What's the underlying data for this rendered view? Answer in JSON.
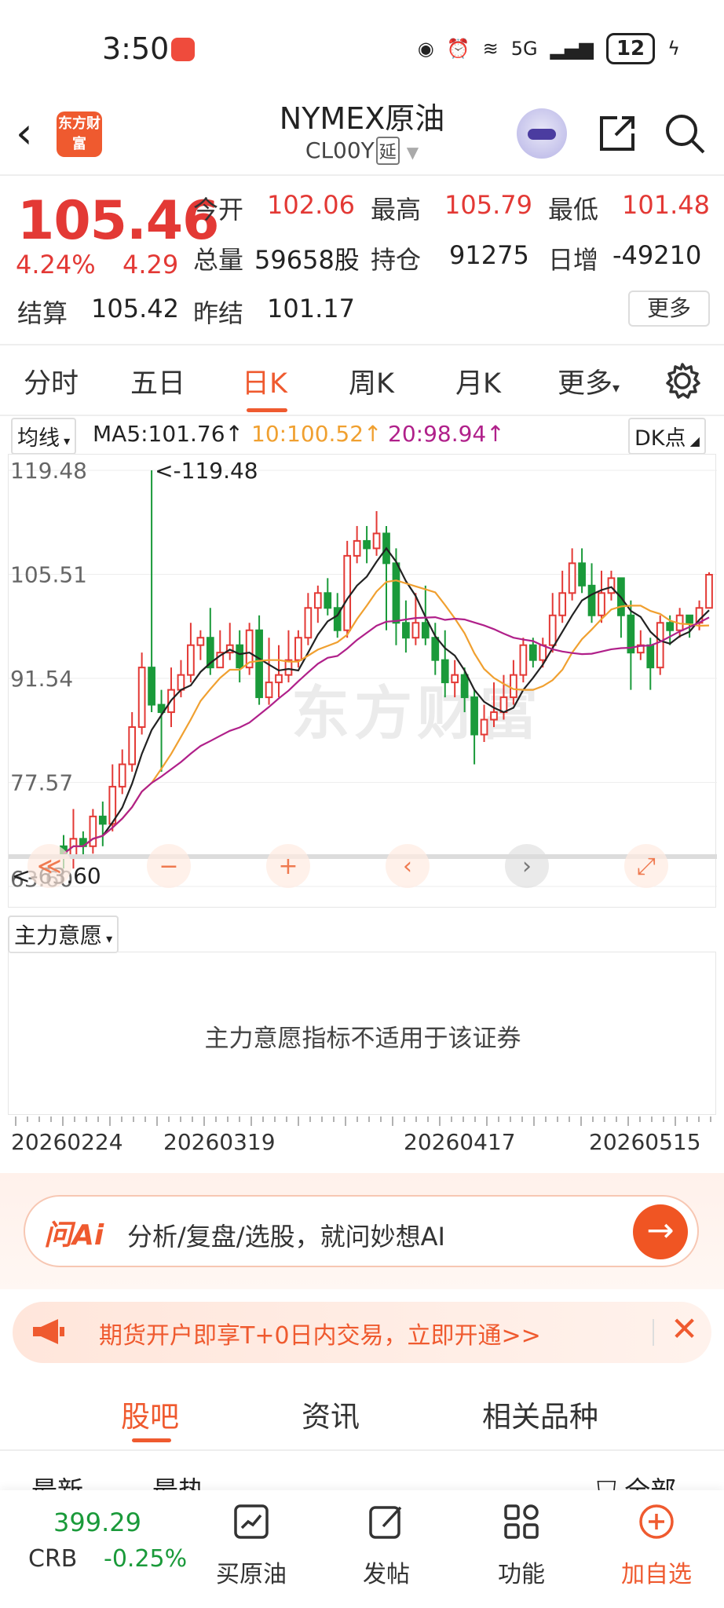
{
  "status_bar": {
    "time": "3:50",
    "network": "5G",
    "battery": "12"
  },
  "header": {
    "title": "NYMEX原油",
    "code": "CL00Y",
    "tag": "延",
    "logo_text": "东方财富"
  },
  "quote": {
    "price": "105.46",
    "change_pct": "4.24%",
    "change": "4.29",
    "open_label": "今开",
    "open": "102.06",
    "high_label": "最高",
    "high": "105.79",
    "low_label": "最低",
    "low": "101.48",
    "volume_label": "总量",
    "volume": "59658股",
    "position_label": "持仓",
    "position": "91275",
    "daily_inc_label": "日增",
    "daily_inc": "-49210",
    "settle_label": "结算",
    "settle": "105.42",
    "prev_settle_label": "昨结",
    "prev_settle": "101.17",
    "more_label": "更多"
  },
  "chart_tabs": {
    "items": [
      "分时",
      "五日",
      "日K",
      "周K",
      "月K",
      "更多"
    ],
    "active": "日K"
  },
  "ma_bar": {
    "dropdown": "均线",
    "ma5": "MA5:101.76↑",
    "ma10": "10:100.52↑",
    "ma20": "20:98.94↑",
    "dk_label": "DK点",
    "colors": {
      "ma5": "#222222",
      "ma10": "#f0a030",
      "ma20": "#b0208a",
      "up": "#e33935",
      "down": "#1a9a3a"
    }
  },
  "chart_data": {
    "type": "candlestick",
    "y_ticks": [
      "119.48",
      "105.51",
      "91.54",
      "77.57",
      "63.60"
    ],
    "ylim": [
      63.6,
      119.48
    ],
    "max_marker": "<-119.48",
    "min_marker": "<-63.60",
    "candles": [
      [
        69,
        68,
        70.5,
        66
      ],
      [
        67.5,
        70,
        74,
        66
      ],
      [
        70,
        69,
        71,
        67.5
      ],
      [
        69,
        73,
        74,
        68
      ],
      [
        73,
        72,
        75,
        69
      ],
      [
        72,
        77,
        80,
        71
      ],
      [
        77,
        80,
        82,
        76
      ],
      [
        80,
        85,
        87,
        79
      ],
      [
        85,
        93,
        95,
        84
      ],
      [
        93,
        88,
        119.48,
        87
      ],
      [
        88,
        87,
        90,
        79
      ],
      [
        87,
        90,
        93,
        85
      ],
      [
        90,
        92,
        94,
        89
      ],
      [
        92,
        96,
        99,
        91
      ],
      [
        96,
        97,
        98,
        94
      ],
      [
        97,
        93,
        101,
        92
      ],
      [
        93,
        95,
        98,
        93
      ],
      [
        95,
        96,
        99,
        94
      ],
      [
        96,
        93,
        98,
        91
      ],
      [
        93,
        98,
        99,
        92
      ],
      [
        98,
        89,
        100,
        88
      ],
      [
        89,
        91,
        97,
        88
      ],
      [
        91,
        92,
        96,
        89
      ],
      [
        92,
        94,
        98,
        91
      ],
      [
        94,
        97,
        98,
        93
      ],
      [
        97,
        101,
        103,
        96
      ],
      [
        101,
        103,
        104,
        99
      ],
      [
        103,
        101,
        105,
        100
      ],
      [
        101,
        98,
        103,
        97
      ],
      [
        98,
        108,
        110,
        97
      ],
      [
        108,
        110,
        112,
        107
      ],
      [
        110,
        109,
        112,
        107
      ],
      [
        109,
        111,
        114,
        108
      ],
      [
        111,
        107,
        112,
        98
      ],
      [
        107,
        99,
        109,
        96
      ],
      [
        99,
        97,
        102,
        95
      ],
      [
        97,
        99,
        103,
        96
      ],
      [
        99,
        97,
        104,
        96
      ],
      [
        97,
        94,
        99,
        92
      ],
      [
        94,
        91,
        98,
        89
      ],
      [
        91,
        92,
        94,
        89
      ],
      [
        92,
        89,
        93,
        87
      ],
      [
        89,
        84,
        90,
        80
      ],
      [
        84,
        86,
        88,
        83
      ],
      [
        86,
        87,
        91,
        85
      ],
      [
        87,
        89,
        92,
        86
      ],
      [
        89,
        92,
        94,
        88
      ],
      [
        92,
        96,
        97,
        91
      ],
      [
        96,
        94,
        97,
        93
      ],
      [
        94,
        96,
        97,
        93
      ],
      [
        96,
        100,
        103,
        95
      ],
      [
        100,
        103,
        106,
        99
      ],
      [
        103,
        107,
        109,
        102
      ],
      [
        107,
        104,
        109,
        103
      ],
      [
        104,
        100,
        107,
        99
      ],
      [
        100,
        103,
        106,
        99
      ],
      [
        103,
        105,
        106,
        102
      ],
      [
        105,
        100,
        105,
        97
      ],
      [
        100,
        95,
        102,
        90
      ],
      [
        95,
        96,
        98,
        94
      ],
      [
        96,
        93,
        97,
        90
      ],
      [
        93,
        99,
        100,
        92
      ],
      [
        99,
        98,
        100,
        96
      ],
      [
        98,
        100,
        101,
        97
      ],
      [
        100,
        99,
        100,
        97
      ],
      [
        99,
        101,
        102,
        98
      ],
      [
        101,
        105.46,
        105.79,
        101.48
      ]
    ],
    "x_ticks": [
      "20260224",
      "20260319",
      "20260417",
      "20260515"
    ],
    "controls": [
      "≪",
      "−",
      "+",
      "‹",
      "›",
      "⤢"
    ]
  },
  "indicator": {
    "dropdown": "主力意愿",
    "message": "主力意愿指标不适用于该证券"
  },
  "ai": {
    "logo": "问Ai",
    "placeholder": "分析/复盘/选股，就问妙想AI",
    "go": "→"
  },
  "promo": {
    "text": "期货开户即享T+0日内交易，立即开通>>",
    "close": "✕"
  },
  "sub_tabs": {
    "items": [
      "股吧",
      "资讯",
      "相关品种"
    ],
    "active": "股吧"
  },
  "filter": {
    "newest": "最新",
    "hottest": "最热",
    "all": "全部"
  },
  "bottom_bar": {
    "crb_value": "399.29",
    "crb_name": "CRB",
    "crb_change": "-0.25%",
    "buy": "买原油",
    "post": "发帖",
    "func": "功能",
    "add": "加自选"
  }
}
